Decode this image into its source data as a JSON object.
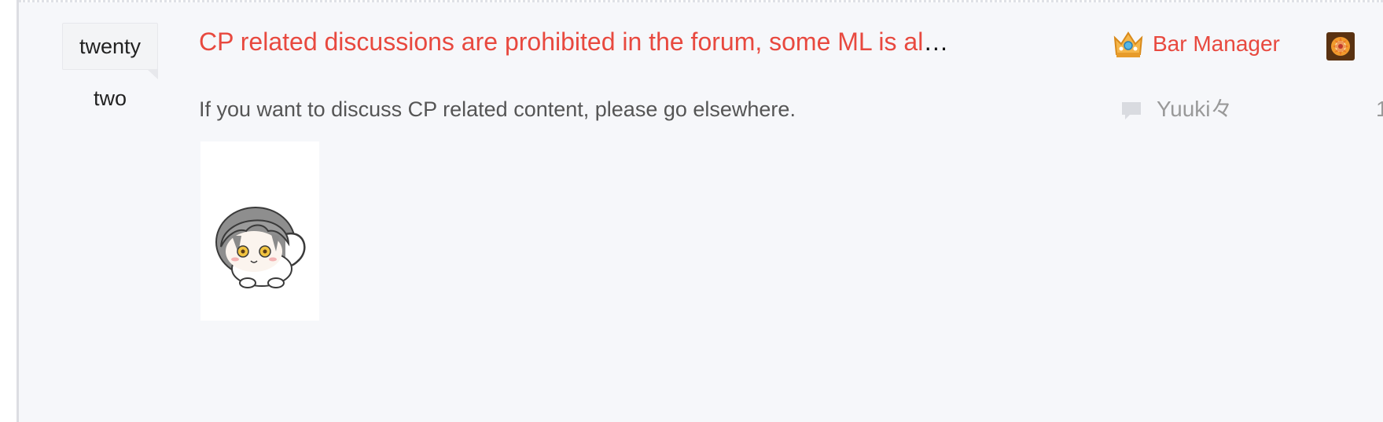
{
  "thread": {
    "reply_count_line1": "twenty",
    "reply_count_line2": "two",
    "title": "CP related discussions are prohibited in the forum, some ML is al",
    "title_ellipsis": "…",
    "excerpt": "If you want to discuss CP related content, please go elsewhere.",
    "thumbnail_icon": "chibi-character-sticker",
    "author": {
      "role_icon": "crown-icon",
      "name": "Bar Manager",
      "level_icon": "level-badge-icon"
    },
    "last_reply": {
      "icon": "comment-icon",
      "name": "Yuuki々",
      "time_peek": "1"
    }
  },
  "colors": {
    "title_red": "#e8493f",
    "background": "#f6f7fa",
    "muted_text": "#999999",
    "body_text": "#555555"
  }
}
